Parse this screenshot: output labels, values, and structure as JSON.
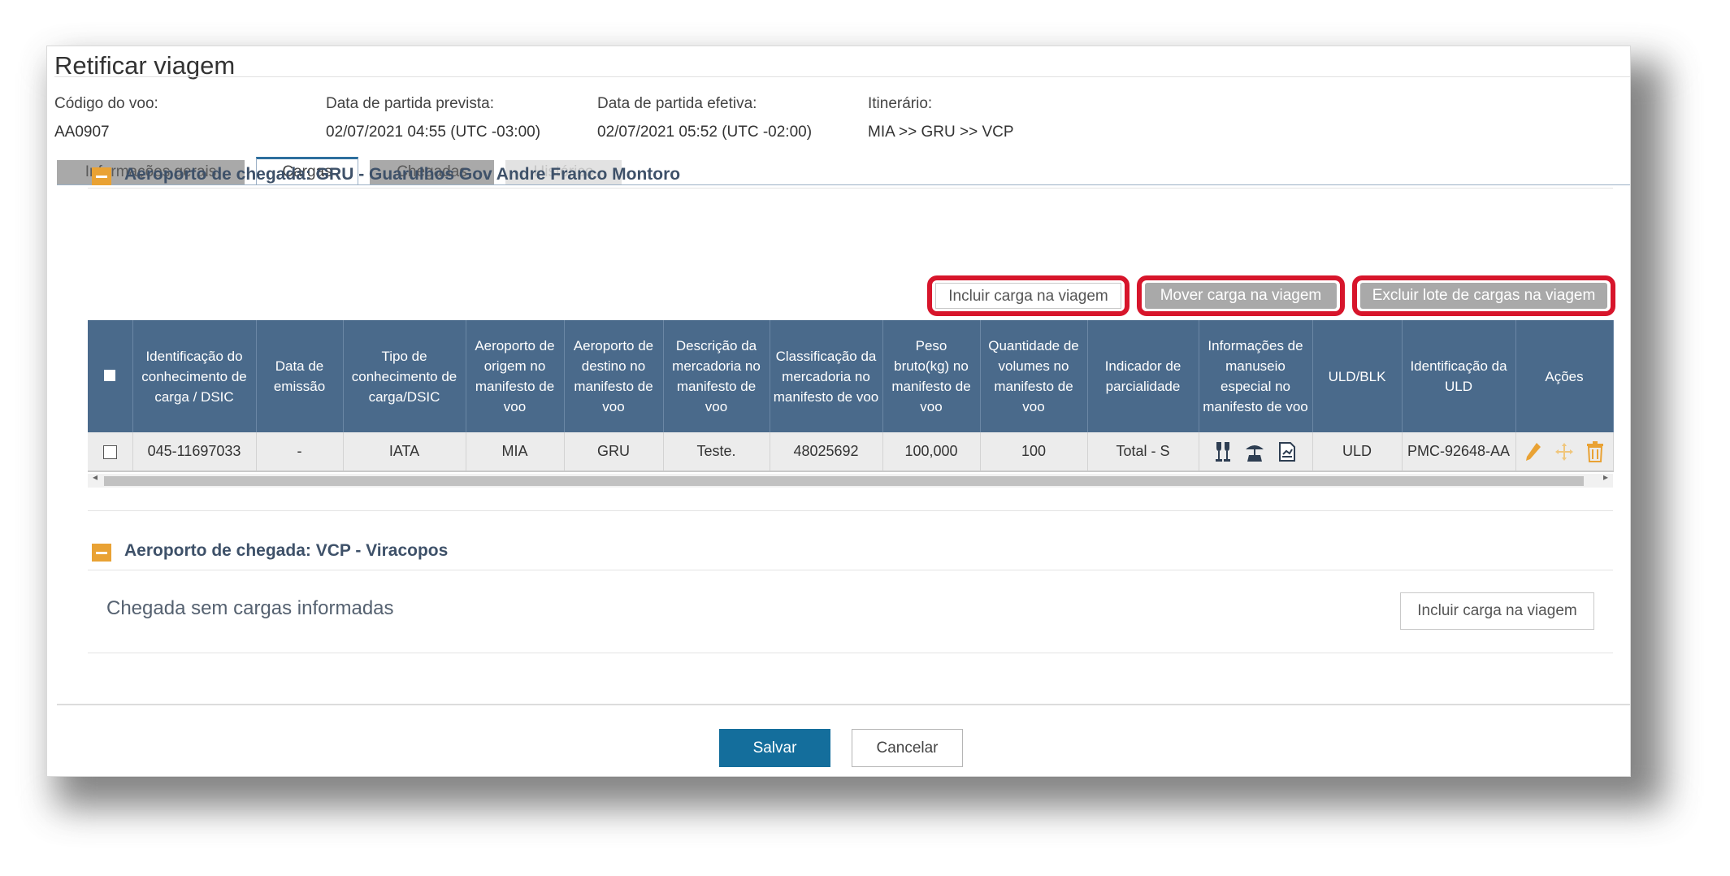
{
  "title": "Retificar viagem",
  "flight_info": [
    {
      "label": "Código do voo:",
      "value": "AA0907"
    },
    {
      "label": "Data de partida prevista:",
      "value": "02/07/2021 04:55 (UTC -03:00)"
    },
    {
      "label": "Data de partida efetiva:",
      "value": "02/07/2021 05:52 (UTC -02:00)"
    },
    {
      "label": "Itinerário:",
      "value": "MIA >> GRU >> VCP"
    }
  ],
  "tabs": [
    {
      "label": "Informações gerais",
      "state": "normal"
    },
    {
      "label": "Cargas",
      "state": "active"
    },
    {
      "label": "Chegadas",
      "state": "normal"
    },
    {
      "label": "Histórico",
      "state": "disabled"
    }
  ],
  "sections": [
    {
      "title": "Aeroporto de chegada: GRU - Guarulhos Gov Andre Franco Montoro",
      "buttons": {
        "include": "Incluir carga na viagem",
        "move": "Mover carga na viagem",
        "delete_batch": "Excluir lote de cargas na viagem"
      },
      "table": {
        "headers": [
          "",
          "Identificação do conhecimento de carga / DSIC",
          "Data de emissão",
          "Tipo de conhecimento de carga/DSIC",
          "Aeroporto de origem no manifesto de voo",
          "Aeroporto de destino no manifesto de voo",
          "Descrição da mercadoria no manifesto de voo",
          "Classificação da mercadoria no manifesto de voo",
          "Peso bruto(kg) no manifesto de voo",
          "Quantidade de volumes no manifesto de voo",
          "Indicador de parcialidade",
          "Informações de manuseio especial no manifesto de voo",
          "ULD/BLK",
          "Identificação da ULD",
          "Ações"
        ],
        "rows": [
          {
            "id": "045-11697033",
            "issue_date": "-",
            "type": "IATA",
            "origin": "MIA",
            "destination": "GRU",
            "description": "Teste.",
            "classification": "48025692",
            "weight": "100,000",
            "volumes": "100",
            "partial": "Total - S",
            "handling_icons": [
              "fragile-glass-icon",
              "keep-dry-icon",
              "document-icon"
            ],
            "uld_blk": "ULD",
            "uld_id": "PMC-92648-AA",
            "action_icons": [
              "edit-pencil-icon",
              "move-icon",
              "trash-icon"
            ]
          }
        ]
      }
    },
    {
      "title": "Aeroporto de chegada: VCP - Viracopos",
      "empty_message": "Chegada sem cargas informadas",
      "include_button": "Incluir carga na viagem"
    }
  ],
  "footer": {
    "save": "Salvar",
    "cancel": "Cancelar"
  },
  "colors": {
    "header_bg": "#4a6a8b",
    "accent_orange": "#e9a234",
    "highlight_red": "#d7152b",
    "primary_button": "#146e9c"
  }
}
